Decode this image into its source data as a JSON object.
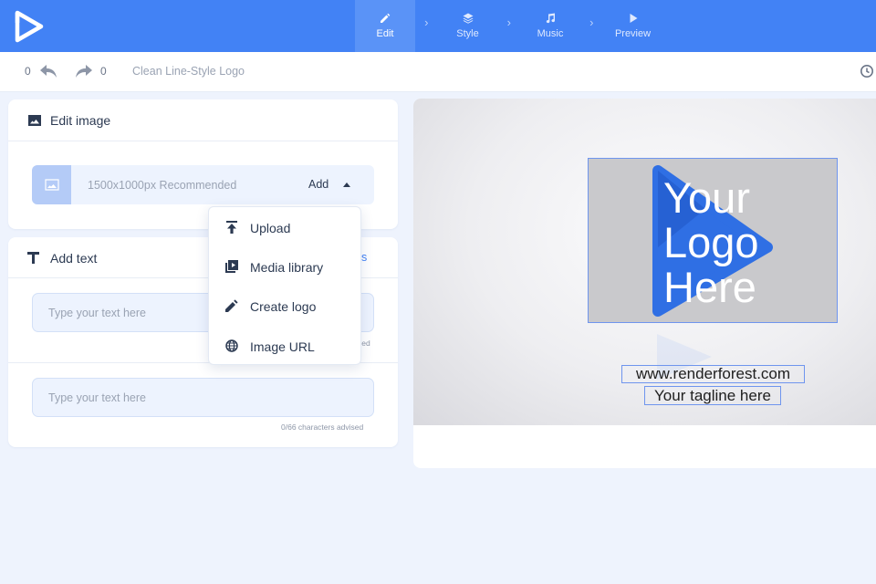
{
  "app": {
    "brand_color": "#4282f5"
  },
  "nav": {
    "steps": [
      {
        "label": "Edit",
        "icon": "pencil-icon",
        "active": true
      },
      {
        "label": "Style",
        "icon": "layers-icon",
        "active": false
      },
      {
        "label": "Music",
        "icon": "music-note-icon",
        "active": false
      },
      {
        "label": "Preview",
        "icon": "play-icon",
        "active": false
      }
    ]
  },
  "toolbar": {
    "undo_count": "0",
    "redo_count": "0",
    "project_title": "Clean Line-Style Logo"
  },
  "edit_image": {
    "title": "Edit image",
    "hint": "1500x1000px Recommended",
    "add_label": "Add"
  },
  "dropdown": {
    "items": [
      {
        "label": "Upload",
        "icon": "upload-icon"
      },
      {
        "label": "Media library",
        "icon": "media-library-icon"
      },
      {
        "label": "Create logo",
        "icon": "pencil-icon"
      },
      {
        "label": "Image URL",
        "icon": "globe-icon"
      }
    ]
  },
  "add_text": {
    "title": "Add text",
    "partial_link": "s",
    "fields": [
      {
        "placeholder": "Type your text here",
        "value": "",
        "counter": "sed"
      },
      {
        "placeholder": "Type your text here",
        "value": "",
        "counter": "0/66 characters advised"
      }
    ]
  },
  "preview": {
    "logo_text": "Your\nLogo\nHere",
    "url": "www.renderforest.com",
    "tagline": "Your tagline here"
  }
}
